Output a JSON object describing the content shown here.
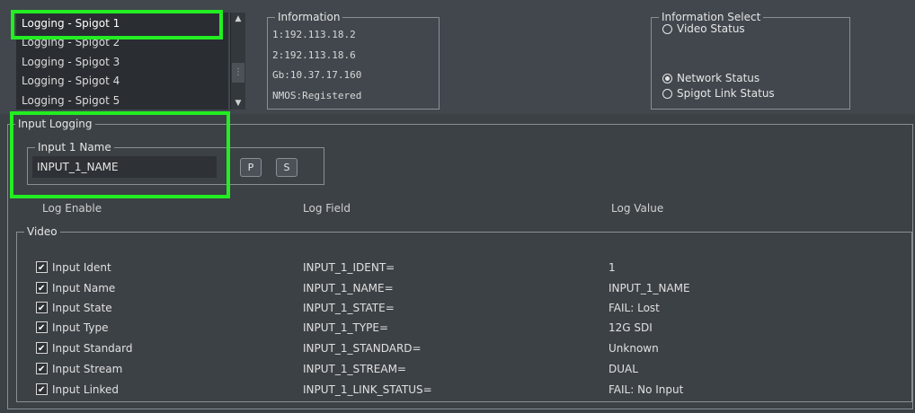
{
  "spigot_list": {
    "items": [
      "Logging - Spigot 1",
      "Logging - Spigot 2",
      "Logging - Spigot 3",
      "Logging - Spigot 4",
      "Logging - Spigot 5"
    ],
    "selected_index": 0
  },
  "information": {
    "title": "Information",
    "lines": [
      "1:192.113.18.2",
      "2:192.113.18.6",
      "Gb:10.37.17.160",
      "NMOS:Registered"
    ]
  },
  "information_select": {
    "title": "Information Select",
    "options": [
      {
        "label": "Video Status",
        "selected": false
      },
      {
        "label": "Network Status",
        "selected": true
      },
      {
        "label": "Spigot Link Status",
        "selected": false
      }
    ]
  },
  "input_logging": {
    "title": "Input Logging",
    "name_group_title": "Input 1 Name",
    "name_value": "INPUT_1_NAME",
    "p_button": "P",
    "s_button": "S",
    "columns": {
      "enable": "Log Enable",
      "field": "Log Field",
      "value": "Log Value"
    },
    "video_title": "Video",
    "rows": [
      {
        "label": "Input Ident",
        "field": "INPUT_1_IDENT=",
        "value": "1",
        "checked": true
      },
      {
        "label": "Input Name",
        "field": "INPUT_1_NAME=",
        "value": "INPUT_1_NAME",
        "checked": true
      },
      {
        "label": "Input State",
        "field": "INPUT_1_STATE=",
        "value": "FAIL: Lost",
        "checked": true
      },
      {
        "label": "Input Type",
        "field": "INPUT_1_TYPE=",
        "value": "12G SDI",
        "checked": true
      },
      {
        "label": "Input Standard",
        "field": "INPUT_1_STANDARD=",
        "value": "Unknown",
        "checked": true
      },
      {
        "label": "Input Stream",
        "field": "INPUT_1_STREAM=",
        "value": "DUAL",
        "checked": true
      },
      {
        "label": "Input Linked",
        "field": "INPUT_1_LINK_STATUS=",
        "value": "FAIL: No Input",
        "checked": true
      }
    ]
  },
  "colors": {
    "highlight": "#22ee22",
    "background": "#3c4146"
  }
}
